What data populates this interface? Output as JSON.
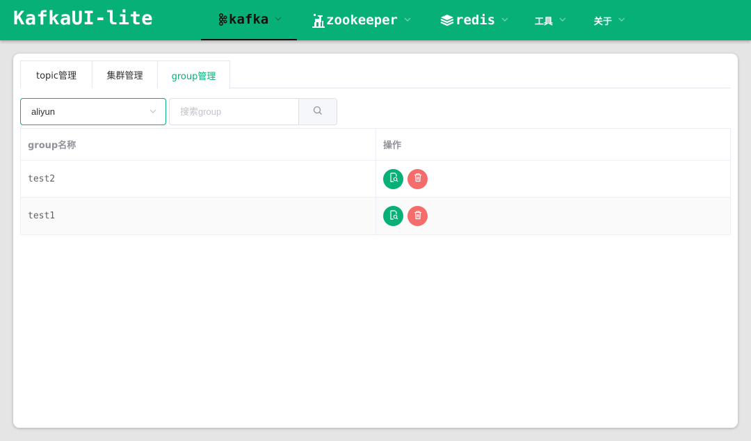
{
  "app": {
    "title": "KafkaUI-lite"
  },
  "colors": {
    "accent": "#07b076",
    "danger": "#f56c6c"
  },
  "nav": [
    {
      "label": "kafka",
      "icon": "kafka-icon",
      "active": true
    },
    {
      "label": "zookeeper",
      "icon": "zookeeper-icon",
      "active": false
    },
    {
      "label": "redis",
      "icon": "redis-icon",
      "active": false
    },
    {
      "label": "工具",
      "active": false
    },
    {
      "label": "关于",
      "active": false
    }
  ],
  "tabs": [
    {
      "label": "topic管理",
      "active": false
    },
    {
      "label": "集群管理",
      "active": false
    },
    {
      "label": "group管理",
      "active": true
    }
  ],
  "cluster_select": {
    "value": "aliyun",
    "icon": "chevron-down-icon"
  },
  "search": {
    "placeholder": "搜索group",
    "value": "",
    "icon": "search-icon"
  },
  "table": {
    "headers": [
      "group名称",
      "操作"
    ],
    "rows": [
      {
        "name": "test2",
        "actions": [
          "view-detail-icon",
          "delete-icon"
        ]
      },
      {
        "name": "test1",
        "actions": [
          "view-detail-icon",
          "delete-icon"
        ]
      }
    ]
  }
}
